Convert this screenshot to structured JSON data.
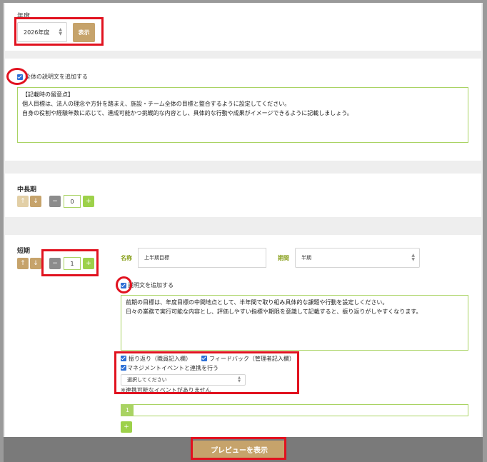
{
  "year": {
    "label": "年度",
    "selected": "2026年度",
    "show_button": "表示"
  },
  "overall": {
    "checkbox_label": "全体の説明文を追加する",
    "text": "【記載時の留意点】\n個人目標は、法人の理念や方針を踏まえ、施設・チーム全体の目標と整合するように設定してください。\n自身の役割や経験年数に応じて、達成可能かつ挑戦的な内容とし、具体的な行動や成果がイメージできるように記載しましょう。"
  },
  "mid_term": {
    "title": "中長期",
    "up": "↑",
    "down": "↓",
    "minus": "−",
    "count": "0",
    "plus": "+"
  },
  "short_term": {
    "title": "短期",
    "up": "↑",
    "down": "↓",
    "minus": "−",
    "count": "1",
    "plus": "+",
    "name_label": "名称",
    "name_value": "上半期目標",
    "period_label": "期間",
    "period_value": "半期",
    "desc_checkbox_label": "説明文を追加する",
    "desc_text": "前期の目標は、年度目標の中間地点として、半年間で取り組み具体的な課題や行動を設定しください。\n日々の業務で実行可能な内容とし、評価しやすい指標や期限を意識して記載すると、振り返りがしやすくなります。",
    "option_reflection": "振り返り（職員記入欄）",
    "option_feedback": "フィードバック（管理者記入欄）",
    "option_management": "マネジメントイベントと連携を行う",
    "event_select_placeholder": "選択してください",
    "event_note": "※連携可能なイベントがありません",
    "tab_number": "1",
    "add_tab": "+"
  },
  "footer": {
    "preview_button": "プレビューを表示"
  },
  "colors": {
    "accent_tan": "#c6a36b",
    "accent_green": "#9dd14a",
    "checkbox_blue": "#2c6fd6",
    "highlight_red": "#e1121f"
  }
}
